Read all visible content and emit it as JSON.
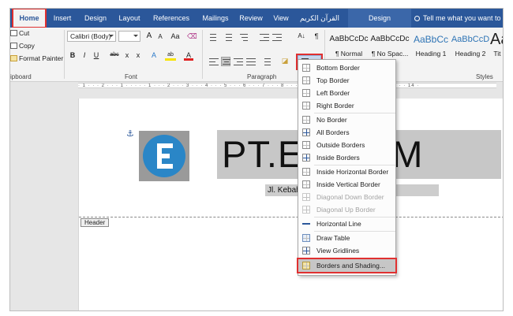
{
  "tabs": [
    {
      "label": "Home",
      "name": "tab-home"
    },
    {
      "label": "Insert",
      "name": "tab-insert"
    },
    {
      "label": "Design",
      "name": "tab-design"
    },
    {
      "label": "Layout",
      "name": "tab-layout"
    },
    {
      "label": "References",
      "name": "tab-references"
    },
    {
      "label": "Mailings",
      "name": "tab-mailings"
    },
    {
      "label": "Review",
      "name": "tab-review"
    },
    {
      "label": "View",
      "name": "tab-view"
    },
    {
      "label": "القرآن الكريم",
      "name": "tab-quran"
    },
    {
      "label": "Design",
      "name": "tab-design-contextual"
    }
  ],
  "tell_me": "Tell me what you want to",
  "clipboard": {
    "cut": "Cut",
    "copy": "Copy",
    "format_painter": "Format Painter",
    "group_label": "ipboard"
  },
  "font": {
    "name": "Calibri (Body)",
    "size": "",
    "grow": "A",
    "shrink": "A",
    "case": "Aa",
    "bold": "B",
    "italic": "I",
    "underline": "U",
    "strike": "abc",
    "subscript": "x",
    "superscript": "x",
    "text_effects": "A",
    "highlight": "ab",
    "font_color": "A",
    "group_label": "Font"
  },
  "paragraph": {
    "group_label": "Paragraph",
    "show_marks": "¶",
    "sort": "A↓"
  },
  "styles": {
    "group_label": "Styles",
    "items": [
      {
        "preview": "AaBbCcDc",
        "name": "¶ Normal"
      },
      {
        "preview": "AaBbCcDc",
        "name": "¶ No Spac..."
      },
      {
        "preview": "AaBbCc",
        "name": "Heading 1"
      },
      {
        "preview": "AaBbCcD",
        "name": "Heading 2"
      },
      {
        "preview": "Aa",
        "name": "Tit"
      }
    ]
  },
  "ruler_text": "· 1 · · · 2 · · · 1 · · · · · 1 · · · 2 · · · 3 · · · 4 · · · 5 · · · 6 · · · 7 · · · 8 · · · 9 · · · 10 · · · 11 · · · 12 · · · 13 · · · 14 ·",
  "document": {
    "title": "PT.EL           COM",
    "address": "Jl. Kebah                              ndoneisa",
    "header_tag": "Header"
  },
  "borders_menu": {
    "items": [
      {
        "label": "Bottom Border",
        "key": "B",
        "disabled": false
      },
      {
        "label": "Top Border",
        "key": "p",
        "disabled": false
      },
      {
        "label": "Left Border",
        "key": "L",
        "disabled": false
      },
      {
        "label": "Right Border",
        "key": "R",
        "disabled": false
      },
      {
        "label": "No Border",
        "key": "N",
        "disabled": false
      },
      {
        "label": "All Borders",
        "key": "A",
        "disabled": false
      },
      {
        "label": "Outside Borders",
        "key": "S",
        "disabled": false
      },
      {
        "label": "Inside Borders",
        "key": "I",
        "disabled": false
      },
      {
        "label": "Inside Horizontal Border",
        "key": "H",
        "disabled": false
      },
      {
        "label": "Inside Vertical Border",
        "key": "V",
        "disabled": false
      },
      {
        "label": "Diagonal Down Border",
        "key": "W",
        "disabled": true
      },
      {
        "label": "Diagonal Up Border",
        "key": "U",
        "disabled": true
      },
      {
        "label": "Horizontal Line",
        "key": "Z",
        "disabled": false
      },
      {
        "label": "Draw Table",
        "key": "D",
        "disabled": false
      },
      {
        "label": "View Gridlines",
        "key": "G",
        "disabled": false
      },
      {
        "label": "Borders and Shading...",
        "key": "O",
        "disabled": false
      }
    ]
  }
}
